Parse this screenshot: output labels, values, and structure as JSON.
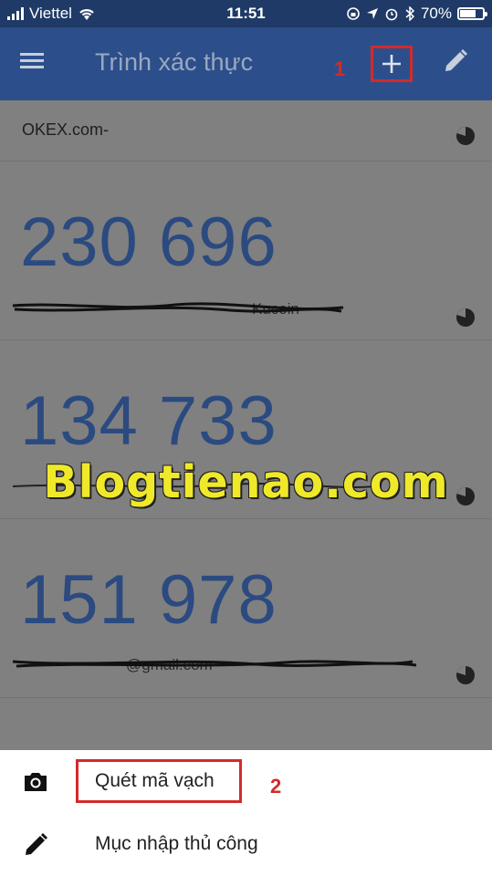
{
  "status_bar": {
    "carrier": "Viettel",
    "time": "11:51",
    "battery_percent": "70%",
    "battery_level": 0.7
  },
  "app_bar": {
    "title": "Trình xác thực",
    "step1_marker": "1",
    "icons": [
      "menu-icon",
      "plus-icon",
      "pencil-icon"
    ]
  },
  "accounts": [
    {
      "issuer": "OKEX.com-",
      "code": "",
      "account": ""
    },
    {
      "issuer": "",
      "code": "230 696",
      "account": "Kucoin"
    },
    {
      "issuer": "",
      "code": "134 733",
      "account": ""
    },
    {
      "issuer": "",
      "code": "151 978",
      "account": "@gmail.com"
    }
  ],
  "watermark": "Blogtienao.com",
  "bottom_sheet": {
    "scan_label": "Quét mã vạch",
    "manual_label": "Mục nhập thủ công",
    "step2_marker": "2"
  },
  "colors": {
    "app_bar": "#2c4f8b",
    "code_text": "#2b4a80",
    "annotation_red": "#d42a2a",
    "watermark": "#f0e92a"
  }
}
